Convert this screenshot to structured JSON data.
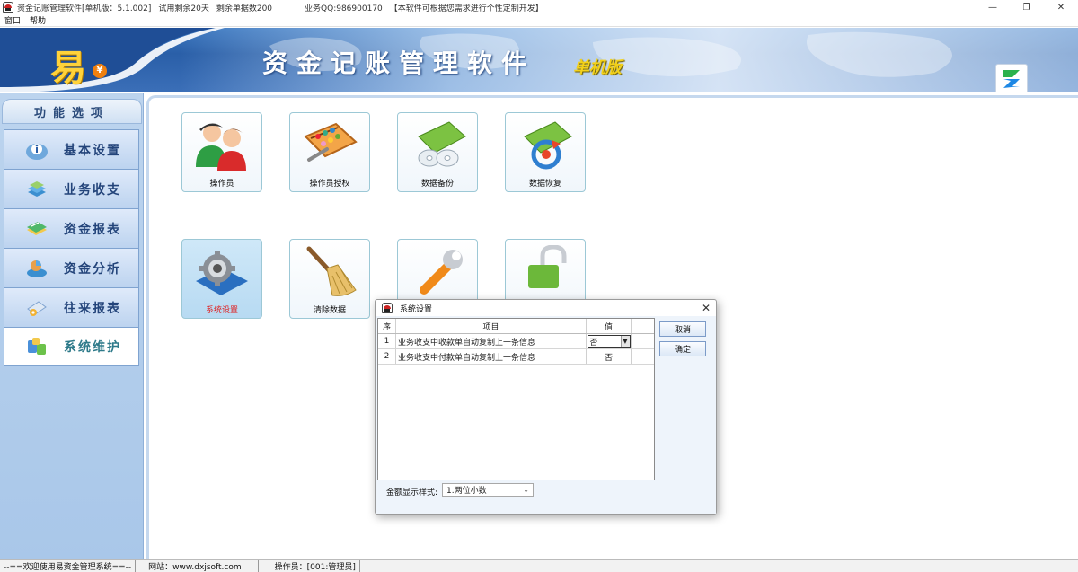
{
  "window": {
    "title_segments": [
      "资金记账管理软件[单机版：5.1.002]",
      "试用剩余20天",
      "剩余单据数200",
      "业务QQ:986900170",
      "【本软件可根据您需求进行个性定制开发】"
    ],
    "controls": {
      "minimize": "—",
      "maximize": "❐",
      "close": "✕"
    }
  },
  "menu": {
    "items": [
      "窗口",
      "帮助"
    ]
  },
  "banner": {
    "logo_char": "易",
    "coin_symbol": "¥",
    "title": "资金记账管理软件",
    "subtitle": "单机版"
  },
  "sidebar": {
    "header": "功能选项",
    "items": [
      {
        "label": "基本设置",
        "icon": "info-icon"
      },
      {
        "label": "业务收支",
        "icon": "stack-icon"
      },
      {
        "label": "资金报表",
        "icon": "report-icon"
      },
      {
        "label": "资金分析",
        "icon": "analysis-icon"
      },
      {
        "label": "往来报表",
        "icon": "exchange-icon"
      },
      {
        "label": "系统维护",
        "icon": "database-icon",
        "active": true
      }
    ]
  },
  "tiles": [
    {
      "label": "操作员",
      "icon": "users-icon"
    },
    {
      "label": "操作员授权",
      "icon": "abacus-icon"
    },
    {
      "label": "数据备份",
      "icon": "backup-disc-icon"
    },
    {
      "label": "数据恢复",
      "icon": "restore-icon"
    },
    {
      "label": "系统设置",
      "icon": "gear-icon",
      "highlight": true
    },
    {
      "label": "清除数据",
      "icon": "broom-icon"
    },
    {
      "label": "",
      "icon": "wrench-icon"
    },
    {
      "label": "",
      "icon": "lock-icon"
    }
  ],
  "dialog": {
    "title": "系统设置",
    "close": "✕",
    "columns": [
      "序",
      "项目",
      "值"
    ],
    "rows": [
      {
        "no": "1",
        "item": "业务收支中收款单自动复制上一条信息",
        "value": "否",
        "editing": true
      },
      {
        "no": "2",
        "item": "业务收支中付款单自动复制上一条信息",
        "value": "否"
      }
    ],
    "cancel_label": "取消",
    "ok_label": "确定",
    "amount_label": "金额显示样式:",
    "amount_value": "1.两位小数"
  },
  "status": {
    "welcome": "--==欢迎使用易资金管理系统==--",
    "website": "网站：www.dxjsoft.com",
    "operator": "操作员：[001:管理员]"
  },
  "colors": {
    "banner_blue": "#2a5fa8",
    "sidebar_blue": "#a9c7e9",
    "highlight_red": "#e01818",
    "title_gold": "#f3d11a"
  }
}
